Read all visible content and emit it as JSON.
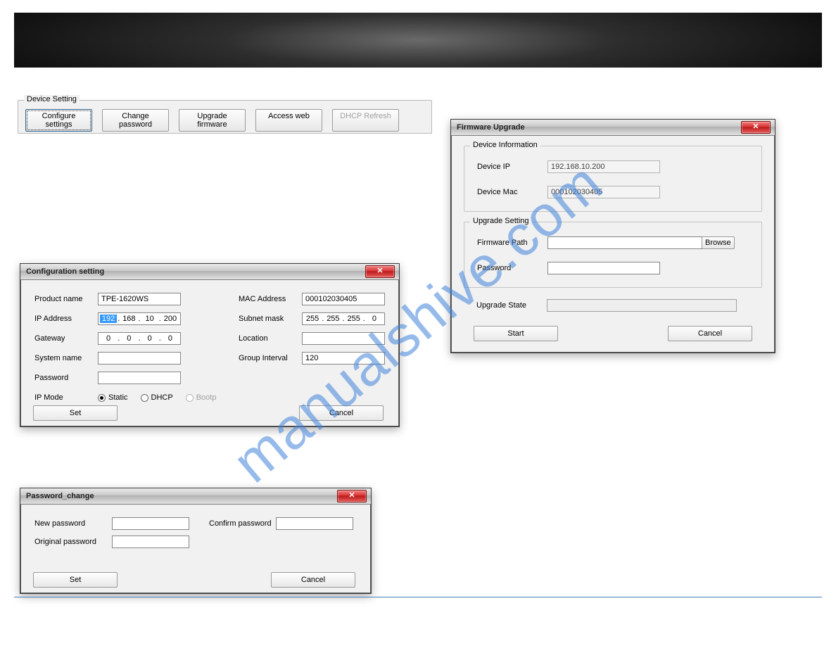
{
  "watermark": "manualshive.com",
  "device_setting": {
    "legend": "Device Setting",
    "buttons": {
      "configure": "Configure settings",
      "change_pw": "Change password",
      "upgrade_fw": "Upgrade firmware",
      "access_web": "Access web",
      "dhcp_refresh": "DHCP Refresh"
    }
  },
  "config_window": {
    "title": "Configuration setting",
    "labels": {
      "product_name": "Product name",
      "ip_address": "IP Address",
      "gateway": "Gateway",
      "system_name": "System name",
      "password": "Password",
      "ip_mode": "IP Mode",
      "mac_address": "MAC Address",
      "subnet_mask": "Subnet mask",
      "location": "Location",
      "group_interval": "Group Interval"
    },
    "values": {
      "product_name": "TPE-1620WS",
      "ip": {
        "a": "192",
        "b": "168",
        "c": "10",
        "d": "200"
      },
      "gateway": {
        "a": "0",
        "b": "0",
        "c": "0",
        "d": "0"
      },
      "system_name": "",
      "password": "",
      "mac_address": "000102030405",
      "subnet": {
        "a": "255",
        "b": "255",
        "c": "255",
        "d": "0"
      },
      "location": "",
      "group_interval": "120"
    },
    "ip_mode": {
      "static": "Static",
      "dhcp": "DHCP",
      "bootp": "Bootp"
    },
    "buttons": {
      "set": "Set",
      "cancel": "Cancel"
    }
  },
  "password_window": {
    "title": "Password_change",
    "labels": {
      "new_password": "New password",
      "confirm_password": "Confirm password",
      "original_password": "Original password"
    },
    "buttons": {
      "set": "Set",
      "cancel": "Cancel"
    }
  },
  "firmware_window": {
    "title": "Firmware Upgrade",
    "groups": {
      "device_info": "Device Information",
      "upgrade_setting": "Upgrade Setting"
    },
    "labels": {
      "device_ip": "Device IP",
      "device_mac": "Device Mac",
      "firmware_path": "Firmware Path",
      "password": "Password",
      "upgrade_state": "Upgrade State"
    },
    "values": {
      "device_ip": "192.168.10.200",
      "device_mac": "000102030405",
      "firmware_path": "",
      "password": "",
      "upgrade_state": ""
    },
    "buttons": {
      "browse": "Browse",
      "start": "Start",
      "cancel": "Cancel"
    }
  }
}
